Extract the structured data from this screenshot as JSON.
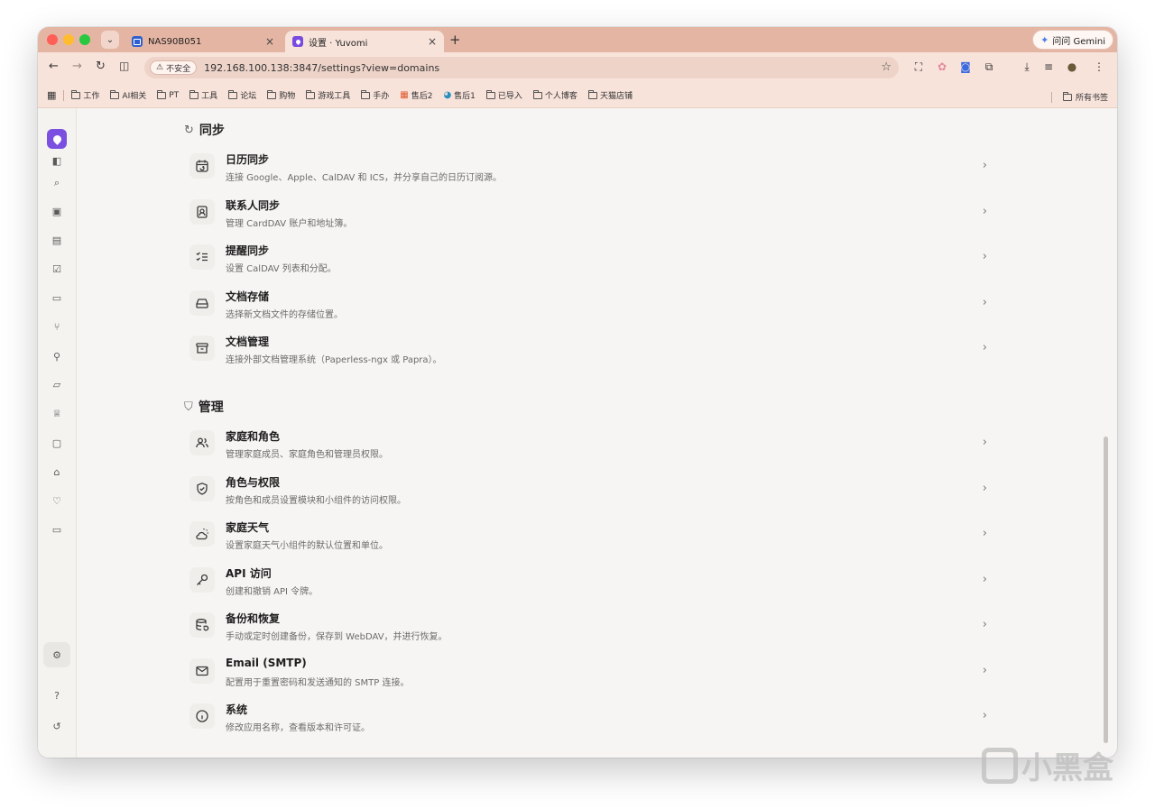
{
  "browser": {
    "tabs": [
      {
        "title": "NAS90B051",
        "close": "×"
      },
      {
        "title": "设置 · Yuvomi",
        "close": "×"
      }
    ],
    "new_tab": "+",
    "gemini": "问问 Gemini",
    "insecure": "不安全",
    "url": "192.168.100.138:3847/settings?view=domains",
    "bookmarks": [
      "工作",
      "AI相关",
      "PT",
      "工具",
      "论坛",
      "购物",
      "游戏工具",
      "手办",
      "售后2",
      "售后1",
      "已导入",
      "个人博客",
      "天猫店铺"
    ],
    "all_bookmarks": "所有书签"
  },
  "sections": [
    {
      "title": "同步",
      "items": [
        {
          "title": "日历同步",
          "desc": "连接 Google、Apple、CalDAV 和 ICS，并分享自己的日历订阅源。",
          "icon": "calendar-sync-icon"
        },
        {
          "title": "联系人同步",
          "desc": "管理 CardDAV 账户和地址簿。",
          "icon": "contact-icon"
        },
        {
          "title": "提醒同步",
          "desc": "设置 CalDAV 列表和分配。",
          "icon": "checklist-icon"
        },
        {
          "title": "文档存储",
          "desc": "选择新文档文件的存储位置。",
          "icon": "hard-drive-icon"
        },
        {
          "title": "文档管理",
          "desc": "连接外部文档管理系统（Paperless-ngx 或 Papra）。",
          "icon": "archive-icon"
        }
      ]
    },
    {
      "title": "管理",
      "items": [
        {
          "title": "家庭和角色",
          "desc": "管理家庭成员、家庭角色和管理员权限。",
          "icon": "users-icon"
        },
        {
          "title": "角色与权限",
          "desc": "按角色和成员设置模块和小组件的访问权限。",
          "icon": "shield-check-icon"
        },
        {
          "title": "家庭天气",
          "desc": "设置家庭天气小组件的默认位置和单位。",
          "icon": "weather-icon"
        },
        {
          "title": "API 访问",
          "desc": "创建和撤销 API 令牌。",
          "icon": "key-icon"
        },
        {
          "title": "备份和恢复",
          "desc": "手动或定时创建备份，保存到 WebDAV，并进行恢复。",
          "icon": "database-restore-icon"
        },
        {
          "title": "Email (SMTP)",
          "desc": "配置用于重置密码和发送通知的 SMTP 连接。",
          "icon": "mail-icon"
        },
        {
          "title": "系统",
          "desc": "修改应用名称，查看版本和许可证。",
          "icon": "info-icon"
        }
      ]
    }
  ],
  "chevron": "›",
  "watermark": "小黑盒"
}
